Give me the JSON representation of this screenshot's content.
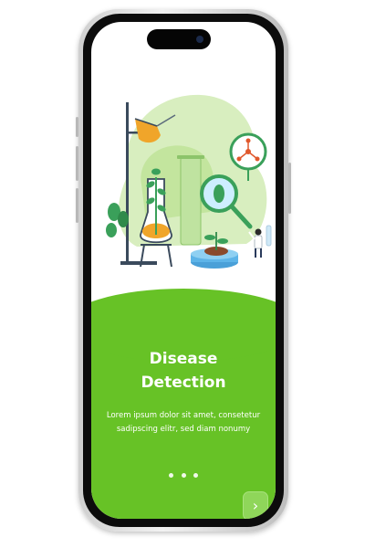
{
  "onboarding": {
    "title_line1": "Disease",
    "title_line2": "Detection",
    "description_line1": "Lorem ipsum dolor sit amet, consetetur",
    "description_line2": "sadipscing elitr, sed diam nonumy",
    "page_indicator": {
      "total": 3
    },
    "next_icon": "chevron-right-icon"
  },
  "colors": {
    "accent": "#67c226",
    "button": "#8fd65a",
    "text_on_accent": "#ffffff"
  }
}
